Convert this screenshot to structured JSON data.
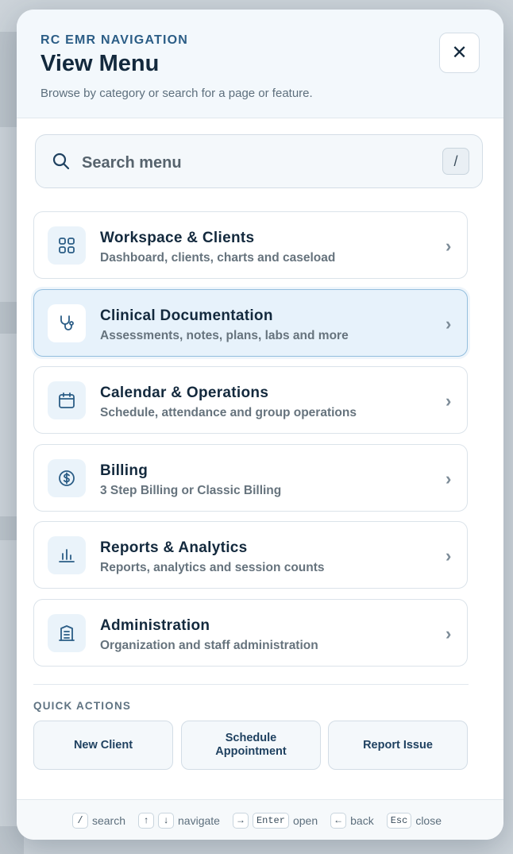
{
  "header": {
    "eyebrow": "RC EMR NAVIGATION",
    "title": "View Menu",
    "subtitle": "Browse by category or search for a page or feature.",
    "close_label": "✕"
  },
  "search": {
    "placeholder": "Search menu",
    "shortcut": "/"
  },
  "categories": [
    {
      "title": "Workspace & Clients",
      "desc": "Dashboard, clients, charts and caseload",
      "icon": "grid-icon",
      "active": false
    },
    {
      "title": "Clinical Documentation",
      "desc": "Assessments, notes, plans, labs and more",
      "icon": "stethoscope-icon",
      "active": true
    },
    {
      "title": "Calendar & Operations",
      "desc": "Schedule, attendance and group operations",
      "icon": "calendar-icon",
      "active": false
    },
    {
      "title": "Billing",
      "desc": "3 Step Billing or Classic Billing",
      "icon": "dollar-icon",
      "active": false
    },
    {
      "title": "Reports & Analytics",
      "desc": "Reports, analytics and session counts",
      "icon": "bar-chart-icon",
      "active": false
    },
    {
      "title": "Administration",
      "desc": "Organization and staff administration",
      "icon": "building-icon",
      "active": false
    }
  ],
  "chevron": "›",
  "quick_actions": {
    "label": "QUICK ACTIONS",
    "buttons": [
      "New Client",
      "Schedule Appointment",
      "Report Issue"
    ]
  },
  "footer": {
    "hints": [
      {
        "keys": [
          "/"
        ],
        "label": "search"
      },
      {
        "keys": [
          "↑",
          "↓"
        ],
        "label": "navigate"
      },
      {
        "keys": [
          "→",
          "Enter"
        ],
        "label": "open"
      },
      {
        "keys": [
          "←"
        ],
        "label": "back"
      },
      {
        "keys": [
          "Esc"
        ],
        "label": "close"
      }
    ]
  },
  "colors": {
    "accent": "#2b5d86",
    "active_bg": "#e7f2fb",
    "title_text": "#13293d"
  }
}
